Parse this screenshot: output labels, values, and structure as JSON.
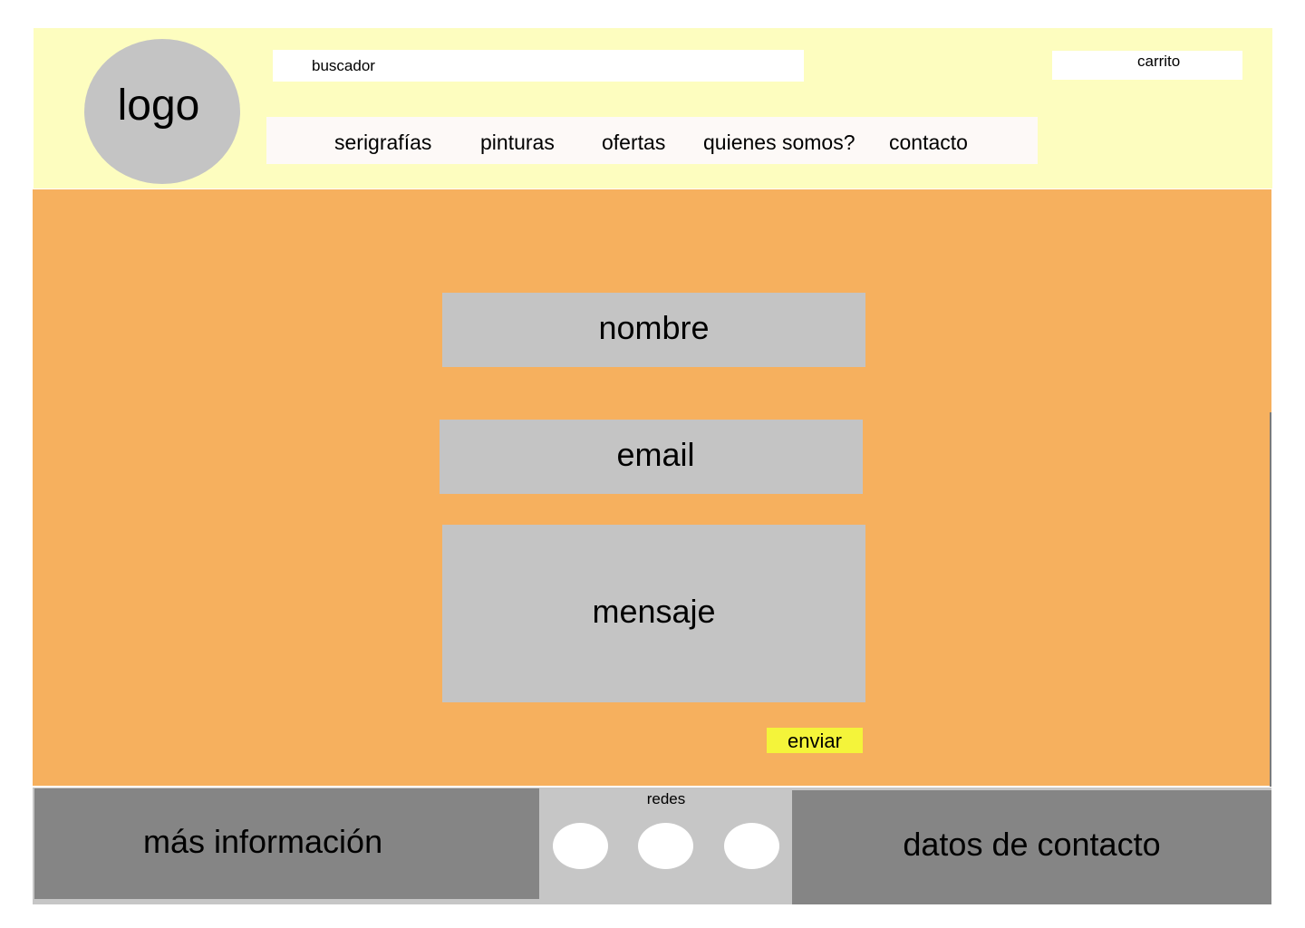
{
  "header": {
    "logo_text": "logo",
    "search_placeholder": "buscador",
    "cart_label": "carrito",
    "nav": [
      {
        "label": "serigrafías"
      },
      {
        "label": "pinturas"
      },
      {
        "label": "ofertas"
      },
      {
        "label": "quienes somos?"
      },
      {
        "label": "contacto"
      }
    ]
  },
  "form": {
    "name_label": "nombre",
    "email_label": "email",
    "message_label": "mensaje",
    "send_label": "enviar"
  },
  "footer": {
    "info_label": "más información",
    "social_label": "redes",
    "contact_label": "datos de contacto"
  },
  "colors": {
    "header_bg": "#fdfdbf",
    "main_bg": "#f6b05e",
    "field_bg": "#c4c4c4",
    "send_bg": "#f4f43a",
    "footer_dark": "#858585",
    "footer_light": "#c6c6c6"
  }
}
